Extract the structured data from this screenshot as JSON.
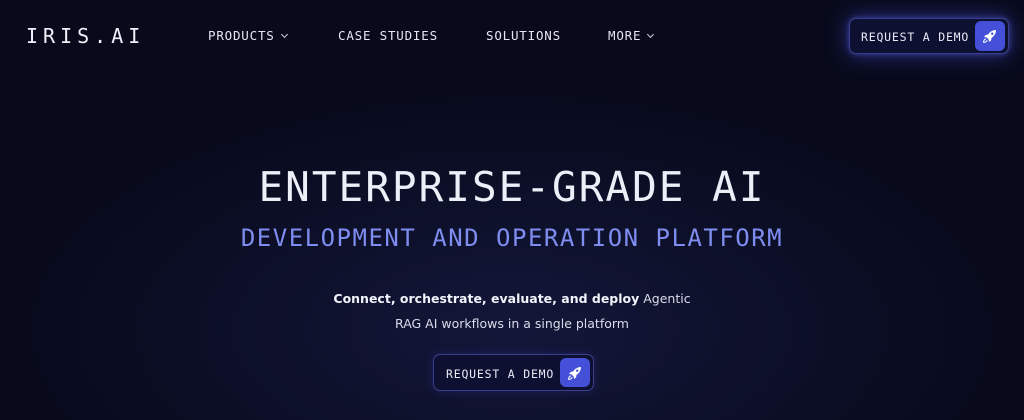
{
  "header": {
    "logo": "IRIS.AI",
    "nav": [
      {
        "label": "PRODUCTS",
        "has_dropdown": true
      },
      {
        "label": "CASE STUDIES",
        "has_dropdown": false
      },
      {
        "label": "SOLUTIONS",
        "has_dropdown": false
      },
      {
        "label": "MORE",
        "has_dropdown": true
      }
    ],
    "cta_label": "REQUEST A DEMO",
    "cta_icon": "rocket-icon"
  },
  "hero": {
    "title": "ENTERPRISE-GRADE AI",
    "subtitle": "DEVELOPMENT AND OPERATION PLATFORM",
    "description_bold": "Connect, orchestrate, evaluate, and deploy",
    "description_rest_line1": " Agentic",
    "description_line2": "RAG AI workflows in a single platform",
    "cta_label": "REQUEST A DEMO",
    "cta_icon": "rocket-icon"
  },
  "colors": {
    "background": "#080a1c",
    "accent": "#4450d8",
    "subtitle": "#7f8cf0"
  }
}
